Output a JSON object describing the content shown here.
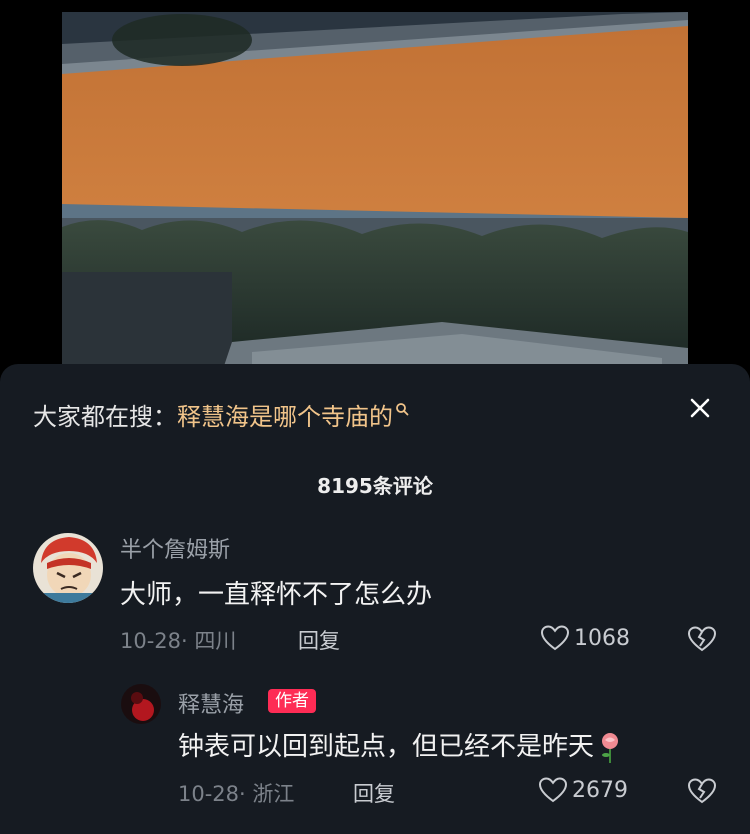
{
  "video": {
    "description_icon": "temple-wall-photo"
  },
  "search_suggest": {
    "prefix": "大家都在搜：",
    "query": "释慧海是哪个寺庙的",
    "icon": "search-icon"
  },
  "close": {
    "icon": "close-icon"
  },
  "comments_header": {
    "count_label": "8195条评论"
  },
  "comments": [
    {
      "username": "半个詹姆斯",
      "text": "大师，一直释怀不了怎么办",
      "meta": "10-28· 四川",
      "reply_label": "回复",
      "likes": "1068"
    }
  ],
  "replies": [
    {
      "username": "释慧海",
      "badge": "作者",
      "text": "钟表可以回到起点，但已经不是昨天",
      "emoji": "rose-icon",
      "meta": "10-28· 浙江",
      "reply_label": "回复",
      "likes": "2679"
    }
  ],
  "colors": {
    "sheet_bg": "#161b22",
    "query": "#f1c48a",
    "badge": "#fe2c55",
    "wall": "#c8773a"
  }
}
